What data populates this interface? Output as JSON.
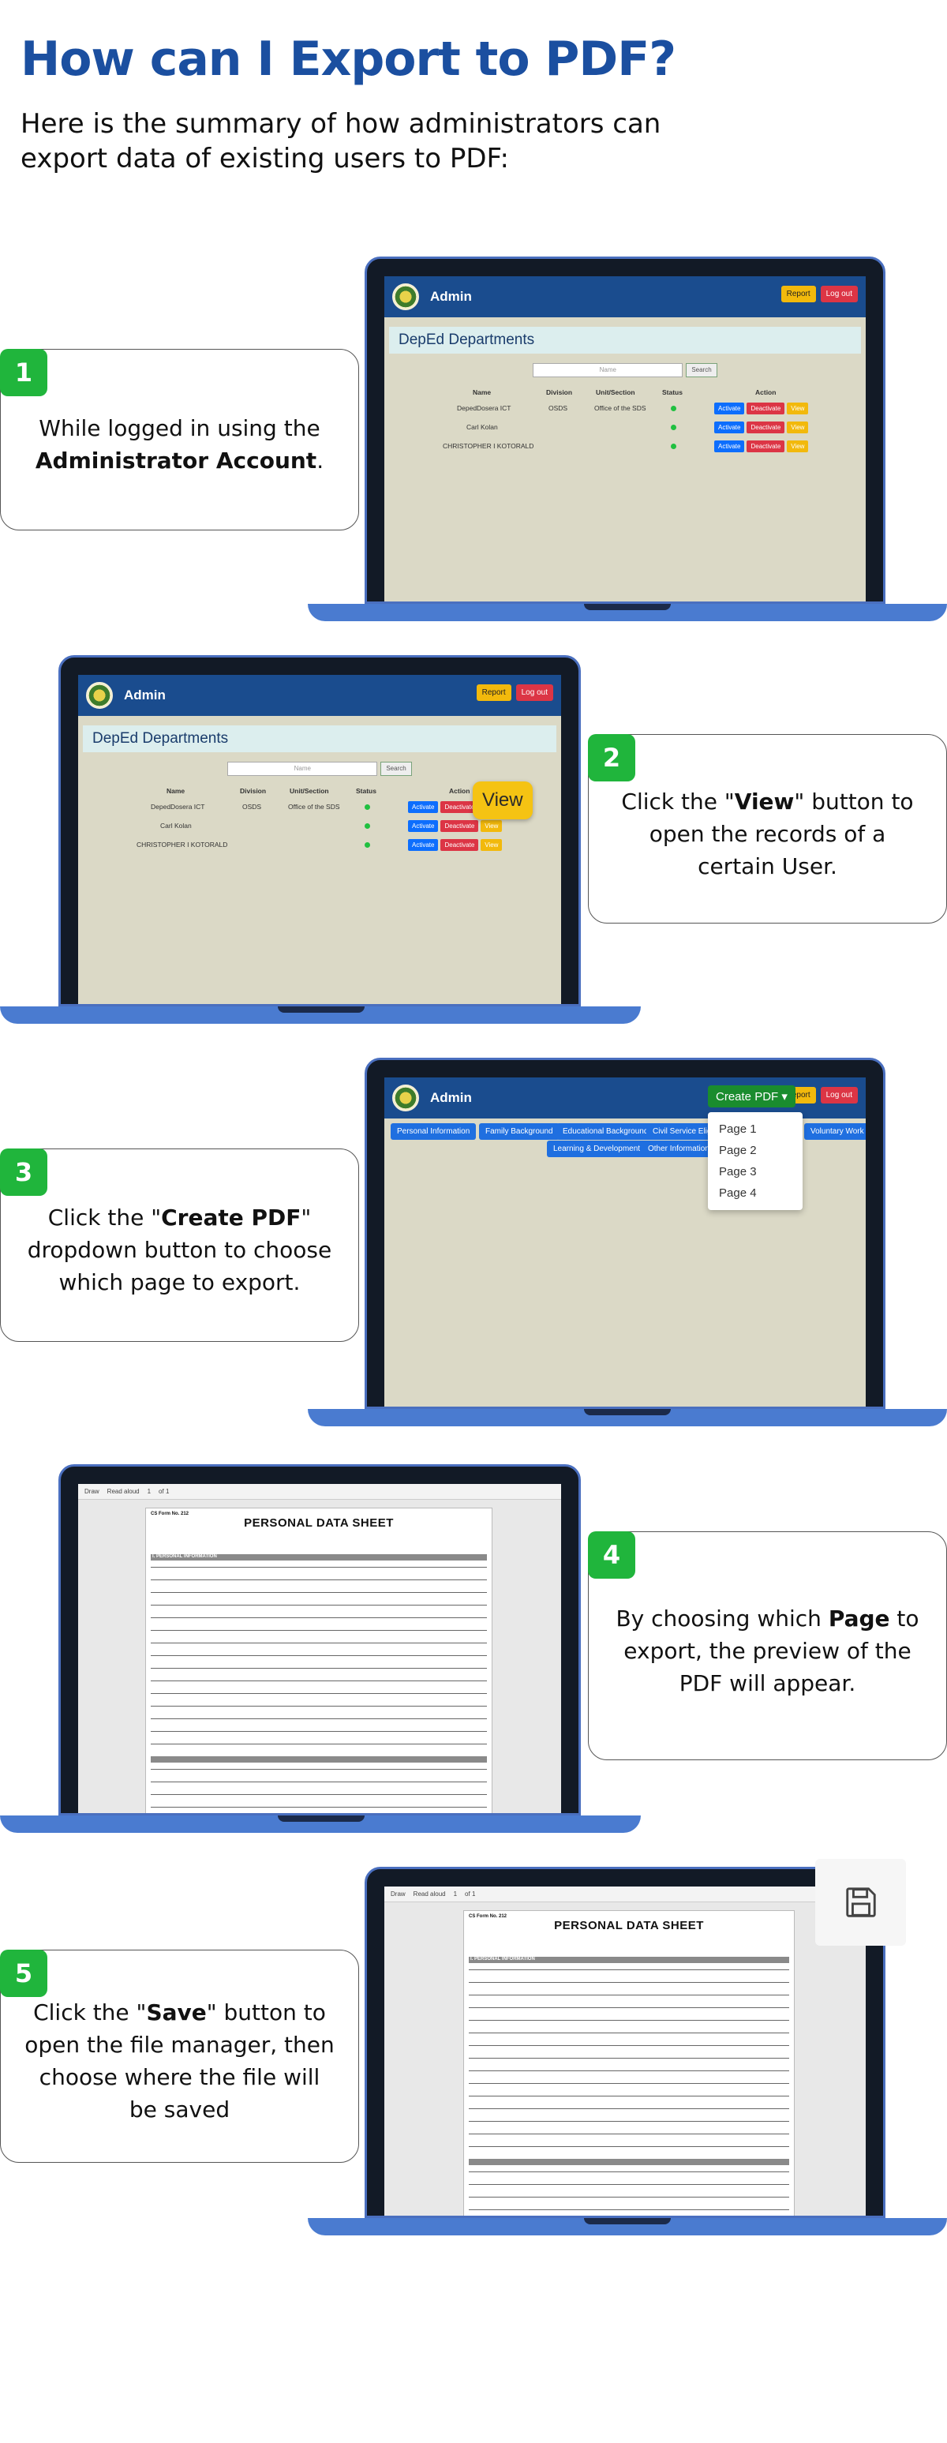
{
  "header": {
    "title": "How can I Export to PDF?",
    "subtitle": "Here is the summary of how administrators can export data of existing users to PDF:"
  },
  "app": {
    "brand": "Admin",
    "report_label": "Report",
    "logout_label": "Log out",
    "departments_heading": "DepEd Departments",
    "search_placeholder": "Name",
    "search_button": "Search",
    "columns": [
      "Name",
      "Division",
      "Unit/Section",
      "Status",
      "Action"
    ],
    "rows": [
      {
        "name": "DepedDosera ICT",
        "division": "OSDS",
        "unit": "Office of the SDS"
      },
      {
        "name": "Carl Kolan",
        "division": "",
        "unit": ""
      },
      {
        "name": "CHRISTOPHER I KOTORALD",
        "division": "",
        "unit": ""
      }
    ],
    "actions": [
      "Activate",
      "Deactivate",
      "View"
    ],
    "view_callout": "View",
    "create_pdf_label": "Create PDF",
    "pdf_pages": [
      "Page 1",
      "Page 2",
      "Page 3",
      "Page 4"
    ],
    "tabs": [
      "Personal Information",
      "Family Background",
      "Educational Background",
      "Civil Service Eligi",
      "Voluntary Work",
      "Learning & Development",
      "Other Information"
    ],
    "pdf_toolbar": [
      "Draw",
      "Read aloud",
      "1",
      "of 1"
    ],
    "pds_title": "PERSONAL DATA SHEET",
    "pds_form": "CS Form No. 212",
    "pds_section": "I. PERSONAL INFORMATION"
  },
  "steps": [
    {
      "number": "1",
      "text_before": "While logged in using the ",
      "bold": "Administrator Account",
      "text_after": "."
    },
    {
      "number": "2",
      "text_before": "Click the \"",
      "bold": "View",
      "text_after": "\" button to open the records of a certain User."
    },
    {
      "number": "3",
      "text_before": "Click the \"",
      "bold": "Create PDF",
      "text_after": "\" dropdown button to choose which page to export."
    },
    {
      "number": "4",
      "text_before": "By choosing which ",
      "bold": "Page",
      "text_after": " to export, the preview of the PDF will appear."
    },
    {
      "number": "5",
      "text_before": "Click the \"",
      "bold": "Save",
      "text_after": "\" button to open the file manager, then choose where the file will be saved"
    }
  ],
  "colors": {
    "title": "#1b4fa0",
    "badge": "#20b53c",
    "navbar": "#1a4c8e",
    "laptop_base": "#4a7bd0"
  },
  "icons": [
    "save-icon",
    "logo-icon"
  ]
}
